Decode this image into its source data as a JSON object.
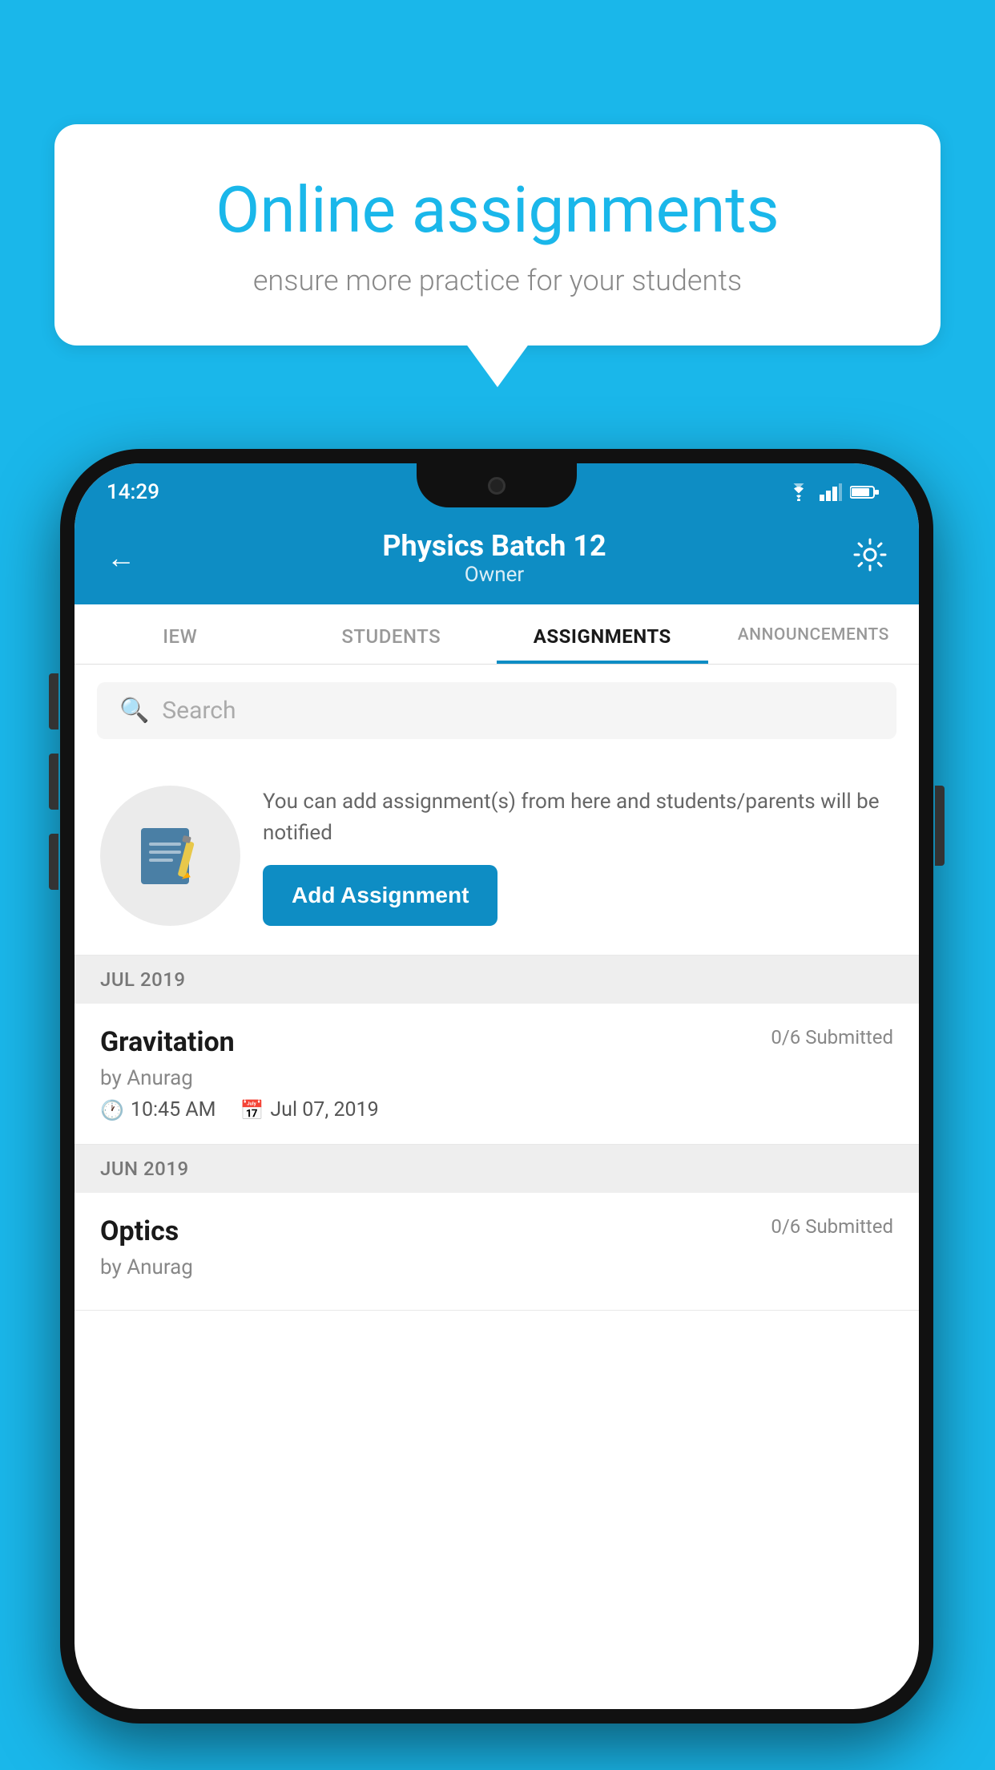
{
  "background": {
    "color": "#1ab7ea"
  },
  "speech_bubble": {
    "title": "Online assignments",
    "subtitle": "ensure more practice for your students"
  },
  "status_bar": {
    "time": "14:29",
    "icons": [
      "wifi",
      "signal",
      "battery"
    ]
  },
  "header": {
    "title": "Physics Batch 12",
    "subtitle": "Owner",
    "back_label": "←",
    "settings_label": "⚙"
  },
  "tabs": [
    {
      "label": "IEW",
      "active": false
    },
    {
      "label": "STUDENTS",
      "active": false
    },
    {
      "label": "ASSIGNMENTS",
      "active": true
    },
    {
      "label": "ANNOUNCEMENTS",
      "active": false
    }
  ],
  "search": {
    "placeholder": "Search"
  },
  "promo": {
    "text": "You can add assignment(s) from here and students/parents will be notified",
    "button_label": "Add Assignment"
  },
  "months": [
    {
      "label": "JUL 2019",
      "assignments": [
        {
          "name": "Gravitation",
          "submitted": "0/6 Submitted",
          "by": "by Anurag",
          "time": "10:45 AM",
          "date": "Jul 07, 2019"
        }
      ]
    },
    {
      "label": "JUN 2019",
      "assignments": [
        {
          "name": "Optics",
          "submitted": "0/6 Submitted",
          "by": "by Anurag",
          "time": "",
          "date": ""
        }
      ]
    }
  ]
}
